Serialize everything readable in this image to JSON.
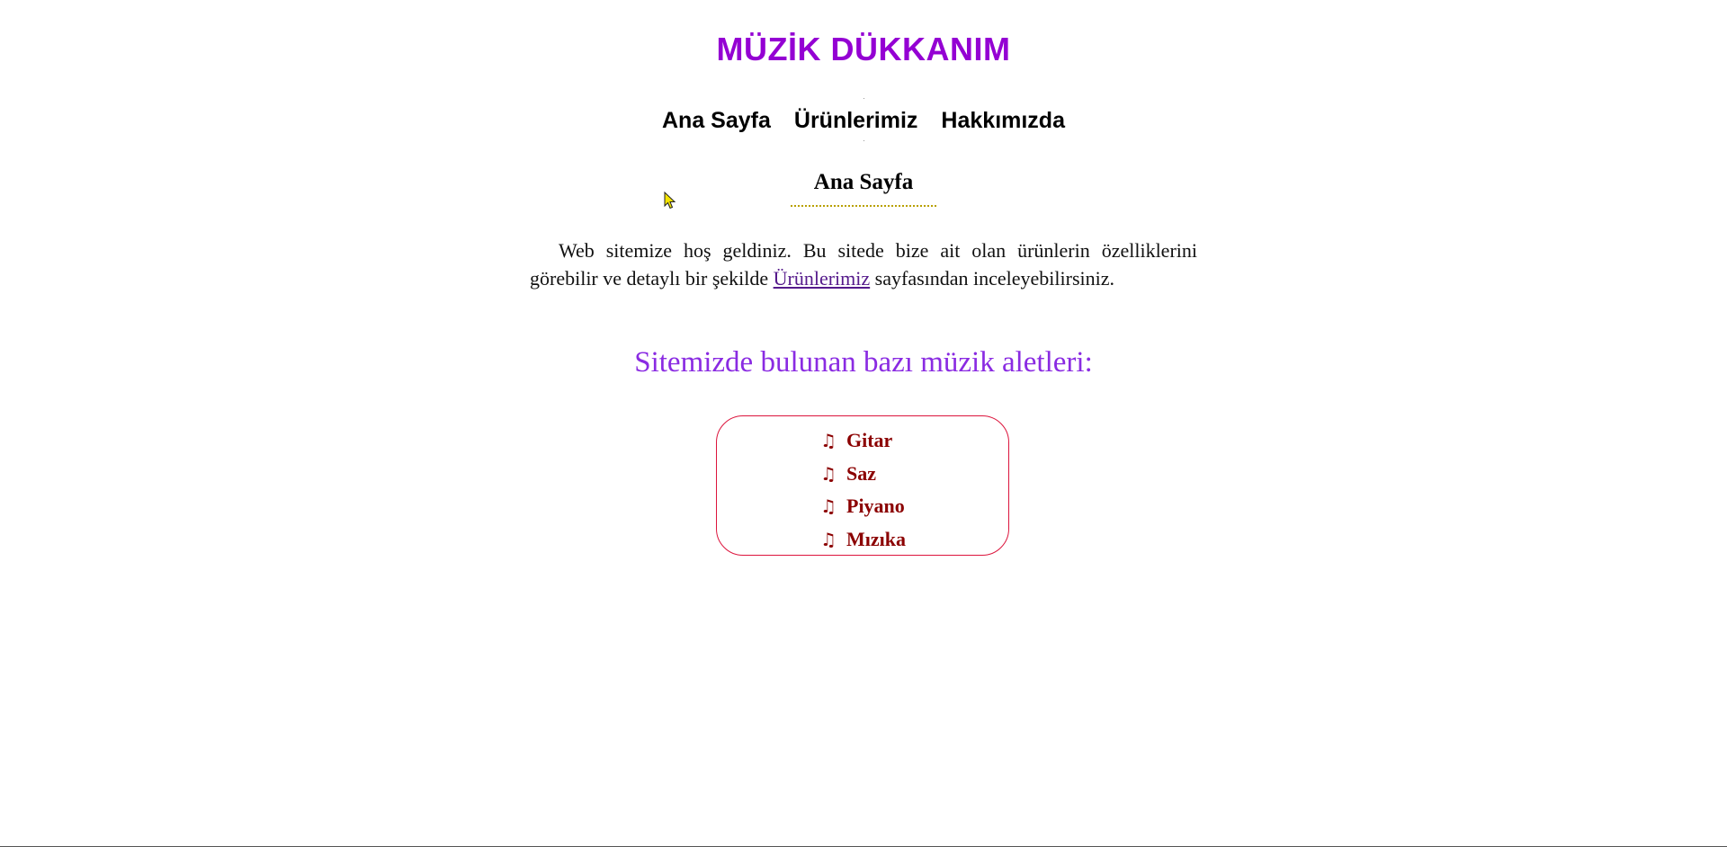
{
  "header": {
    "title": "MÜZİK DÜKKANIM"
  },
  "nav": {
    "items": [
      {
        "label": "Ana Sayfa"
      },
      {
        "label": "Ürünlerimiz"
      },
      {
        "label": "Hakkımızda"
      }
    ]
  },
  "main": {
    "section_title": "Ana Sayfa",
    "intro_before": "Web sitemize hoş geldiniz. Bu sitede bize ait olan ürünlerin özelliklerini görebilir ve detaylı bir şekilde ",
    "intro_link": "Ürünlerimiz",
    "intro_after": " sayfasından inceleyebilirsiniz.",
    "instruments_heading": "Sitemizde bulunan bazı müzik aletleri:",
    "instruments": [
      {
        "label": "Gitar",
        "icon": "music-note-icon"
      },
      {
        "label": "Saz",
        "icon": "music-note-icon"
      },
      {
        "label": "Piyano",
        "icon": "music-note-icon"
      },
      {
        "label": "Mızıka",
        "icon": "music-note-icon"
      }
    ]
  },
  "colors": {
    "title": "#9400d3",
    "instruments_heading": "#8a2be2",
    "list_text": "#8b0000",
    "list_border": "#dc143c",
    "heading_underline": "#b8a000",
    "link": "#551a8b"
  }
}
